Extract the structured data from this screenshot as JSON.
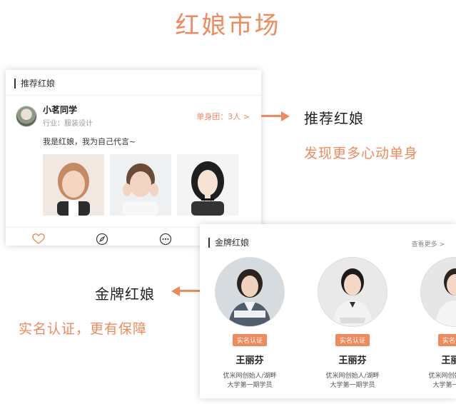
{
  "page": {
    "title": "红娘市场"
  },
  "recommend_card": {
    "header": "推荐红娘",
    "user": {
      "name": "小茗同学",
      "industry": "行业：服装设计",
      "single_group": "单身团：3人 >"
    },
    "quote": "我是红娘，我为自己代言~",
    "tabs": [
      "heart-icon",
      "compass-icon",
      "more-icon"
    ]
  },
  "right_label": {
    "title": "推荐红娘",
    "subtitle": "发现更多心动单身"
  },
  "left_label": {
    "title": "金牌红娘",
    "subtitle": "实名认证，更有保障"
  },
  "gold_card": {
    "header": "金牌红娘",
    "more": "查看更多 >",
    "matchmakers": [
      {
        "badge": "实名认证",
        "name": "王丽芬",
        "desc1": "优米网创始人/湖畔",
        "desc2": "大学第一期学员"
      },
      {
        "badge": "实名认证",
        "name": "王丽芬",
        "desc1": "优米网创始人/湖畔",
        "desc2": "大学第一期学员"
      },
      {
        "badge": "实名认证",
        "name": "王丽芬",
        "desc1": "优米网创始人/湖畔",
        "desc2": "大学第一期学员"
      }
    ]
  },
  "colors": {
    "accent": "#f08a5d",
    "text": "#333333"
  }
}
